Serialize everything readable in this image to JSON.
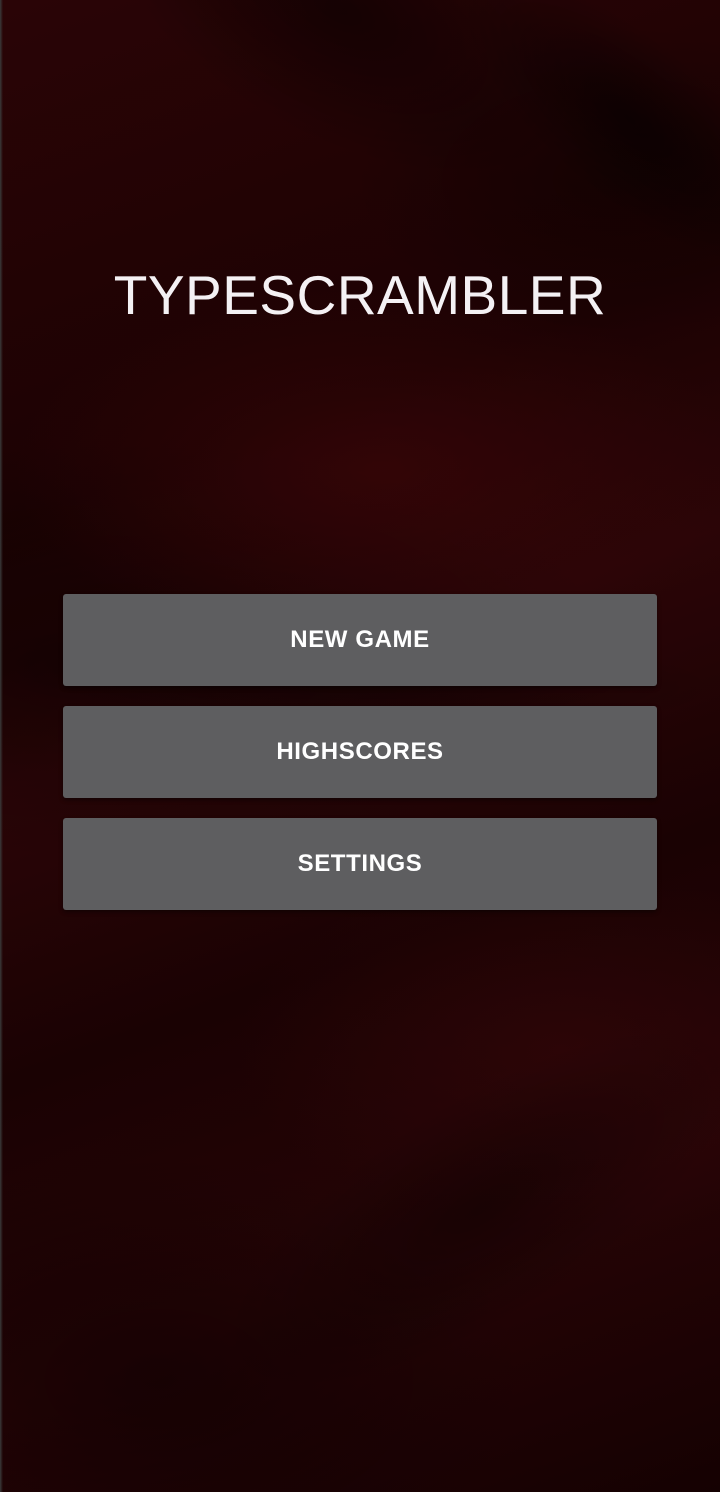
{
  "app": {
    "title": "TYPESCRAMBLER"
  },
  "menu": {
    "buttons": [
      {
        "id": "new_game",
        "label": "NEW GAME"
      },
      {
        "id": "highscores",
        "label": "HIGHSCORES"
      },
      {
        "id": "settings",
        "label": "SETTINGS"
      }
    ]
  },
  "colors": {
    "background": "#1f0304",
    "button": "#5e5e60",
    "title_text": "#f4f1f4",
    "button_text": "#ffffff"
  }
}
